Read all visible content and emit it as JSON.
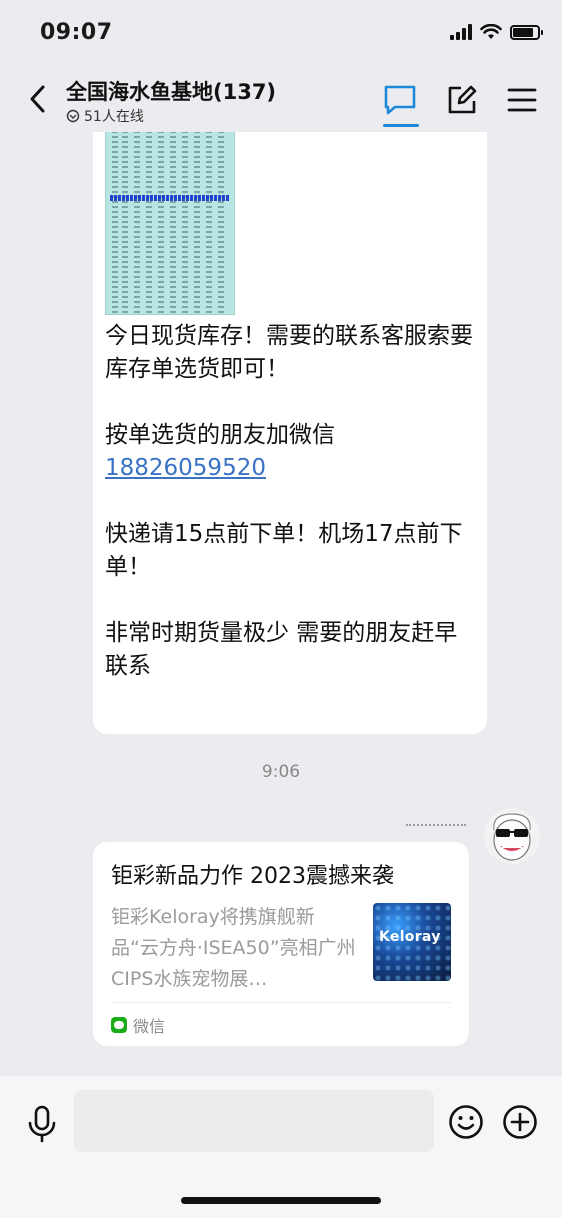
{
  "status_bar": {
    "time": "09:07",
    "battery_level": 0.85
  },
  "header": {
    "title": "全国海水鱼基地(137)",
    "online_text": "51人在线",
    "active_tab": "chat",
    "accent_color": "#1e88d8"
  },
  "messages": [
    {
      "type": "text_with_image",
      "image_icon": "stock-list-image",
      "paragraphs": [
        "今日现货库存！需要的联系客服索要库存单选货即可！",
        "按单选货的朋友加微信",
        "18826059520",
        "快递请15点前下单！机场17点前下单！",
        "非常时期货量极少 需要的朋友赶早联系"
      ]
    }
  ],
  "timestamp": "9:06",
  "link_card": {
    "title": "钜彩新品力作 2023震撼来袭",
    "description": "钜彩Keloray将携旗舰新品“云方舟·ISEA50”亮相广州CIPS水族宠物展…",
    "thumb_logo": "Keloray",
    "source": "微信",
    "source_color": "#1aad19"
  },
  "input": {
    "placeholder": ""
  }
}
